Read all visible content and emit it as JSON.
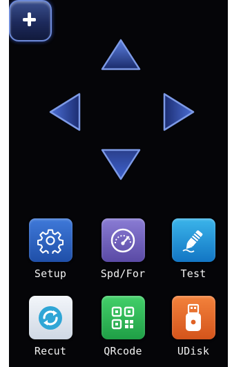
{
  "dpad": {
    "up": "arrow-up-icon",
    "down": "arrow-down-icon",
    "left": "arrow-left-icon",
    "right": "arrow-right-icon",
    "center": "plus-icon",
    "accent_color": "#4a6fd8"
  },
  "apps": [
    {
      "label": "Setup",
      "icon": "gear-icon",
      "color": "#2f63c4"
    },
    {
      "label": "Spd/For",
      "icon": "speedometer-icon",
      "color": "#7263c0"
    },
    {
      "label": "Test",
      "icon": "pen-test-icon",
      "color": "#2196d8"
    },
    {
      "label": "Recut",
      "icon": "refresh-icon",
      "color": "#e8eef5"
    },
    {
      "label": "QRcode",
      "icon": "qrcode-icon",
      "color": "#2fb85a"
    },
    {
      "label": "UDisk",
      "icon": "usb-drive-icon",
      "color": "#e86a2b"
    }
  ]
}
